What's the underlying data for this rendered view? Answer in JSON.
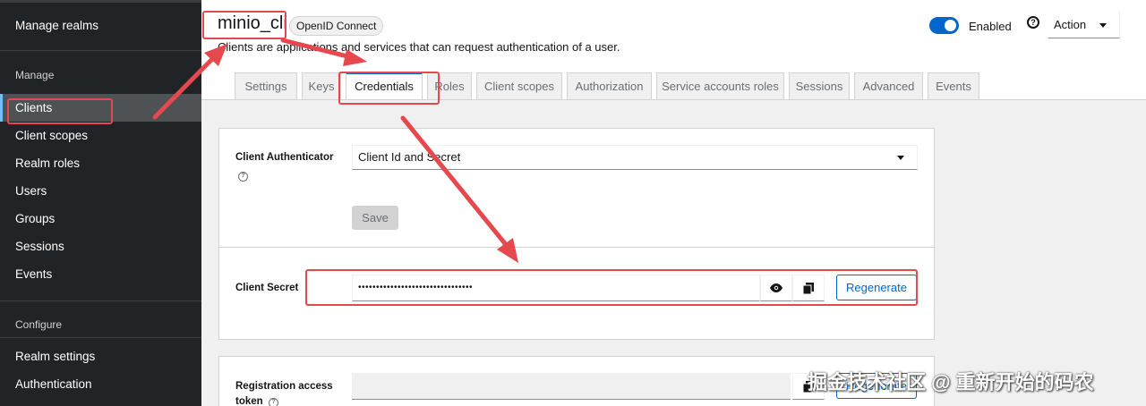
{
  "sidebar": {
    "manage_realms": "Manage realms",
    "manage_section": "Manage",
    "items": [
      "Clients",
      "Client scopes",
      "Realm roles",
      "Users",
      "Groups",
      "Sessions",
      "Events"
    ],
    "configure_section": "Configure",
    "config_items": [
      "Realm settings",
      "Authentication"
    ]
  },
  "header": {
    "title": "minio_cli",
    "badge": "OpenID Connect",
    "subtitle": "Clients are applications and services that can request authentication of a user.",
    "enabled_label": "Enabled",
    "enabled": true,
    "help_icon": "?",
    "action_label": "Action"
  },
  "tabs": [
    "Settings",
    "Keys",
    "Credentials",
    "Roles",
    "Client scopes",
    "Authorization",
    "Service accounts roles",
    "Sessions",
    "Advanced",
    "Events"
  ],
  "active_tab": "Credentials",
  "credentials": {
    "client_authenticator_label": "Client Authenticator",
    "client_authenticator_value": "Client Id and Secret",
    "help_small": "?",
    "save_label": "Save",
    "client_secret_label": "Client Secret",
    "client_secret_value": "••••••••••••••••••••••••••••••••",
    "regenerate_label": "Regenerate",
    "registration_label_line1": "Registration access",
    "registration_label_line2": "token",
    "regenerate_partial_label": "Regenerate"
  },
  "watermark": "掘金技术社区 @ 重新开始的码农",
  "colors": {
    "accent": "#0066cc",
    "annotation": "#e5484d",
    "sidebar": "#212427"
  }
}
